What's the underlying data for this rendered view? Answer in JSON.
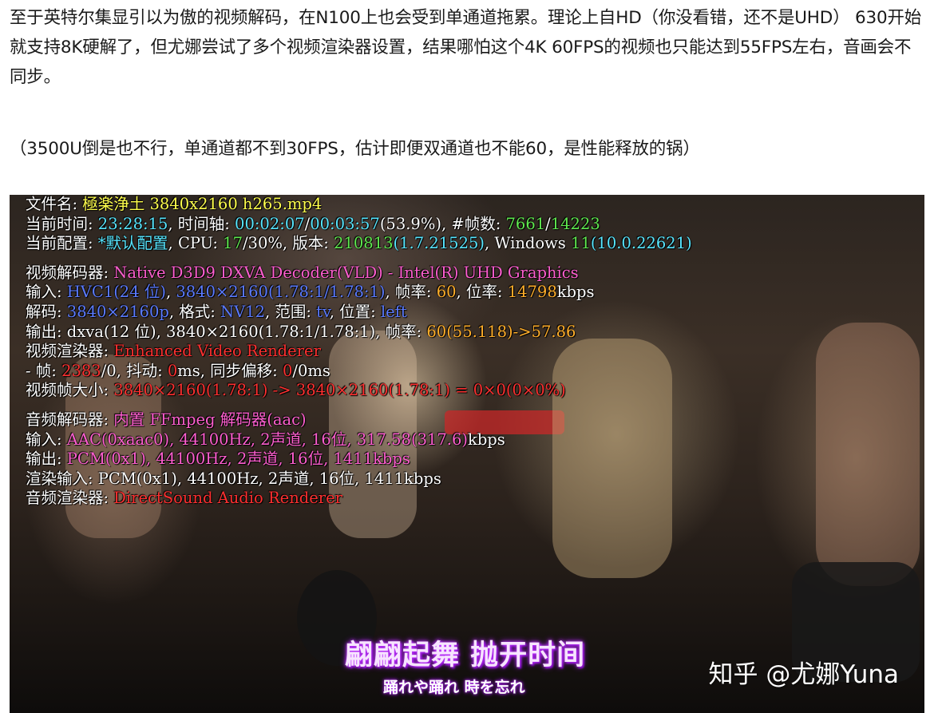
{
  "article": {
    "paragraph1": "至于英特尔集显引以为傲的视频解码，在N100上也会受到单通道拖累。理论上自HD（你没看错，还不是UHD） 630开始就支持8K硬解了，但尤娜尝试了多个视频渲染器设置，结果哪怕这个4K 60FPS的视频也只能达到55FPS左右，音画会不同步。",
    "paragraph2": "（3500U倒是也不行，单通道都不到30FPS，估计即便双通道也不能60，是性能释放的锅）"
  },
  "screenshot": {
    "osd": {
      "file_label": "文件名:",
      "file_value": "極楽浄土 3840x2160 h265.mp4",
      "time_label": "当前时间:",
      "time_value": "23:28:15",
      "timeline_label": ", 时间轴:",
      "timeline_pos": "00:02:07",
      "timeline_sep": "/",
      "timeline_total": "00:03:57",
      "timeline_pct": "(53.9%)",
      "frames_label": ", #帧数:",
      "frames_cur": "7661",
      "frames_total": "14223",
      "config_label": "当前配置:",
      "config_value": "*默认配置",
      "cpu_label": ", CPU:",
      "cpu_value": "17",
      "cpu_max": "/30%",
      "version_label": ", 版本:",
      "version_value": "210813",
      "version_build": "(1.7.21525)",
      "windows_label": ", Windows",
      "windows_value": "11",
      "windows_build": "(10.0.22621)",
      "vdec_label": "视频解码器:",
      "vdec_value": "Native D3D9 DXVA Decoder(VLD) - Intel(R) UHD Graphics",
      "vin_label": "输入:",
      "vin_codec": "HVC1(24 位)",
      "vin_sep": ",",
      "vin_res": "3840×2160",
      "vin_ratio": "(1.78:1/1.78:1)",
      "vin_fps_label": ", 帧率:",
      "vin_fps": "60",
      "vin_bitrate_label": ", 位率:",
      "vin_bitrate": "14798",
      "vin_bitrate_unit": "kbps",
      "vdecode_label": "解码:",
      "vdecode_res": "3840×2160p",
      "vdecode_fmt_label": ", 格式:",
      "vdecode_fmt": "NV12",
      "vdecode_range_label": ", 范围:",
      "vdecode_range": "tv",
      "vdecode_pos_label": ", 位置:",
      "vdecode_pos": "left",
      "vout_label": "输出:",
      "vout_value": "dxva(12 位), 3840×2160(1.78:1/1.78:1)",
      "vout_fps_label": ", 帧率:",
      "vout_fps": "60",
      "vout_fps_actual": "(55.118)",
      "vout_fps_arrow": "->57.86",
      "vrender_label": "视频渲染器:",
      "vrender_value": "Enhanced Video Renderer",
      "drop_label": " - 帧:",
      "drop_value": "2383",
      "drop_sep": "/0",
      "jitter_label": ", 抖动:",
      "jitter_value": "0",
      "jitter_unit": "ms",
      "sync_label": ", 同步偏移:",
      "sync_value": "0",
      "sync_unit": "/0ms",
      "vsize_label": "视频帧大小:",
      "vsize_value": "3840×2160(1.78:1) -> 3840×2160(1.78:1) = 0×0(0×0%)",
      "adec_label": "音频解码器:",
      "adec_value": "内置 FFmpeg 解码器(aac)",
      "ain_label": "输入:",
      "ain_codec": "AAC(0xaac0)",
      "ain_rate": ", 44100Hz",
      "ain_ch": ", 2声道",
      "ain_bits": ", 16位",
      "ain_bitrate": ", 317.58(317.6)",
      "ain_unit": "kbps",
      "aout_label": "输出:",
      "aout_codec": "PCM(0x1)",
      "aout_rate": ", 44100Hz",
      "aout_ch": ", 2声道",
      "aout_bits": ", 16位",
      "aout_bitrate": ", 1411kbps",
      "arin_label": "渲染输入:",
      "arin_value": "PCM(0x1), 44100Hz, 2声道, 16位, 1411kbps",
      "arender_label": "音频渲染器:",
      "arender_value": "DirectSound Audio Renderer"
    },
    "subtitle_cn": "翩翩起舞 抛开时间",
    "subtitle_jp": "踊れや踊れ 時を忘れ",
    "watermark": "知乎 @尤娜Yuna"
  },
  "colors": {
    "yellow": "#ffff4d",
    "cyan": "#57e6ff",
    "green": "#5fe84f",
    "red": "#ff3030",
    "pink": "#ff5fd0",
    "blue": "#5b7bff",
    "subtitle_glow": "#c53cff"
  }
}
